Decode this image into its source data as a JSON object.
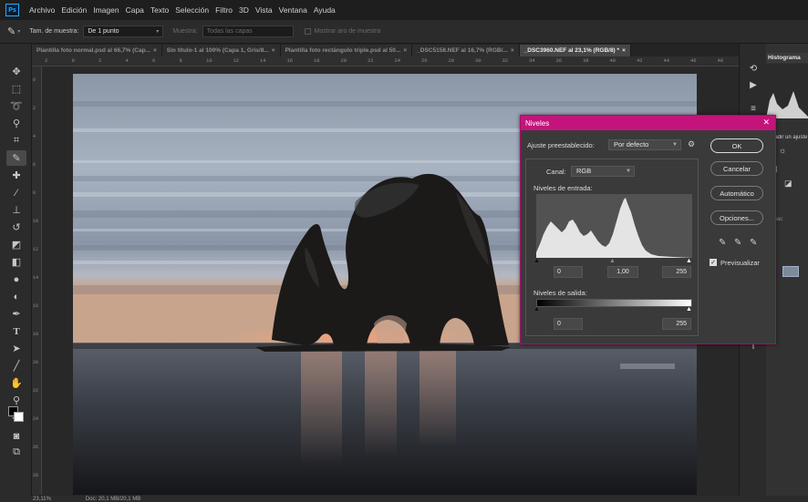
{
  "menubar": {
    "app_logo": "Ps",
    "items": [
      "Archivo",
      "Edición",
      "Imagen",
      "Capa",
      "Texto",
      "Selección",
      "Filtro",
      "3D",
      "Vista",
      "Ventana",
      "Ayuda"
    ]
  },
  "options": {
    "sample_size_label": "Tam. de muestra:",
    "sample_size_value": "De 1 punto",
    "sample_label": "Muestra:",
    "sample_value": "Todas las capas",
    "show_ring_label": "Mostrar aro de muestra"
  },
  "tabs": [
    {
      "label": "Plantilla foto normal.psd al 66,7% (Cap...",
      "active": false
    },
    {
      "label": "Sin título-1 al 100% (Capa 1, Gris/8...",
      "active": false
    },
    {
      "label": "Plantilla foto rectángulo triple.psd al 50...",
      "active": false
    },
    {
      "label": "_DSC5158.NEF al 16,7% (RGB/...",
      "active": false
    },
    {
      "label": "_DSC3960.NEF al 23,1% (RGB/8) *",
      "active": true
    }
  ],
  "ruler_ticks": [
    "2",
    "0",
    "2",
    "4",
    "6",
    "8",
    "10",
    "12",
    "14",
    "16",
    "18",
    "20",
    "22",
    "24",
    "26",
    "28",
    "30",
    "32",
    "34",
    "36",
    "38",
    "40",
    "42",
    "44",
    "46",
    "48"
  ],
  "ruler_v_ticks": [
    "0",
    "2",
    "4",
    "6",
    "8",
    "10",
    "12",
    "14",
    "16",
    "18",
    "20",
    "22",
    "24",
    "26",
    "28"
  ],
  "levels": {
    "title": "Niveles",
    "preset_label": "Ajuste preestablecido:",
    "preset_value": "Por defecto",
    "channel_label": "Canal:",
    "channel_value": "RGB",
    "input_label": "Niveles de entrada:",
    "input_black": "0",
    "input_gamma": "1,00",
    "input_white": "255",
    "output_label": "Niveles de salida:",
    "output_black": "0",
    "output_white": "255",
    "ok": "OK",
    "cancel": "Cancelar",
    "auto": "Automático",
    "options": "Opciones...",
    "preview_label": "Previsualizar",
    "preview_checked": true
  },
  "panels": {
    "histogram_tab": "Histograma",
    "adjust_hint": "Añadir un ajuste",
    "opacity_hint": "Opac"
  },
  "status": {
    "zoom": "23,11%",
    "doc_info": "Doc: 20,1 MB/20,1 MB"
  }
}
